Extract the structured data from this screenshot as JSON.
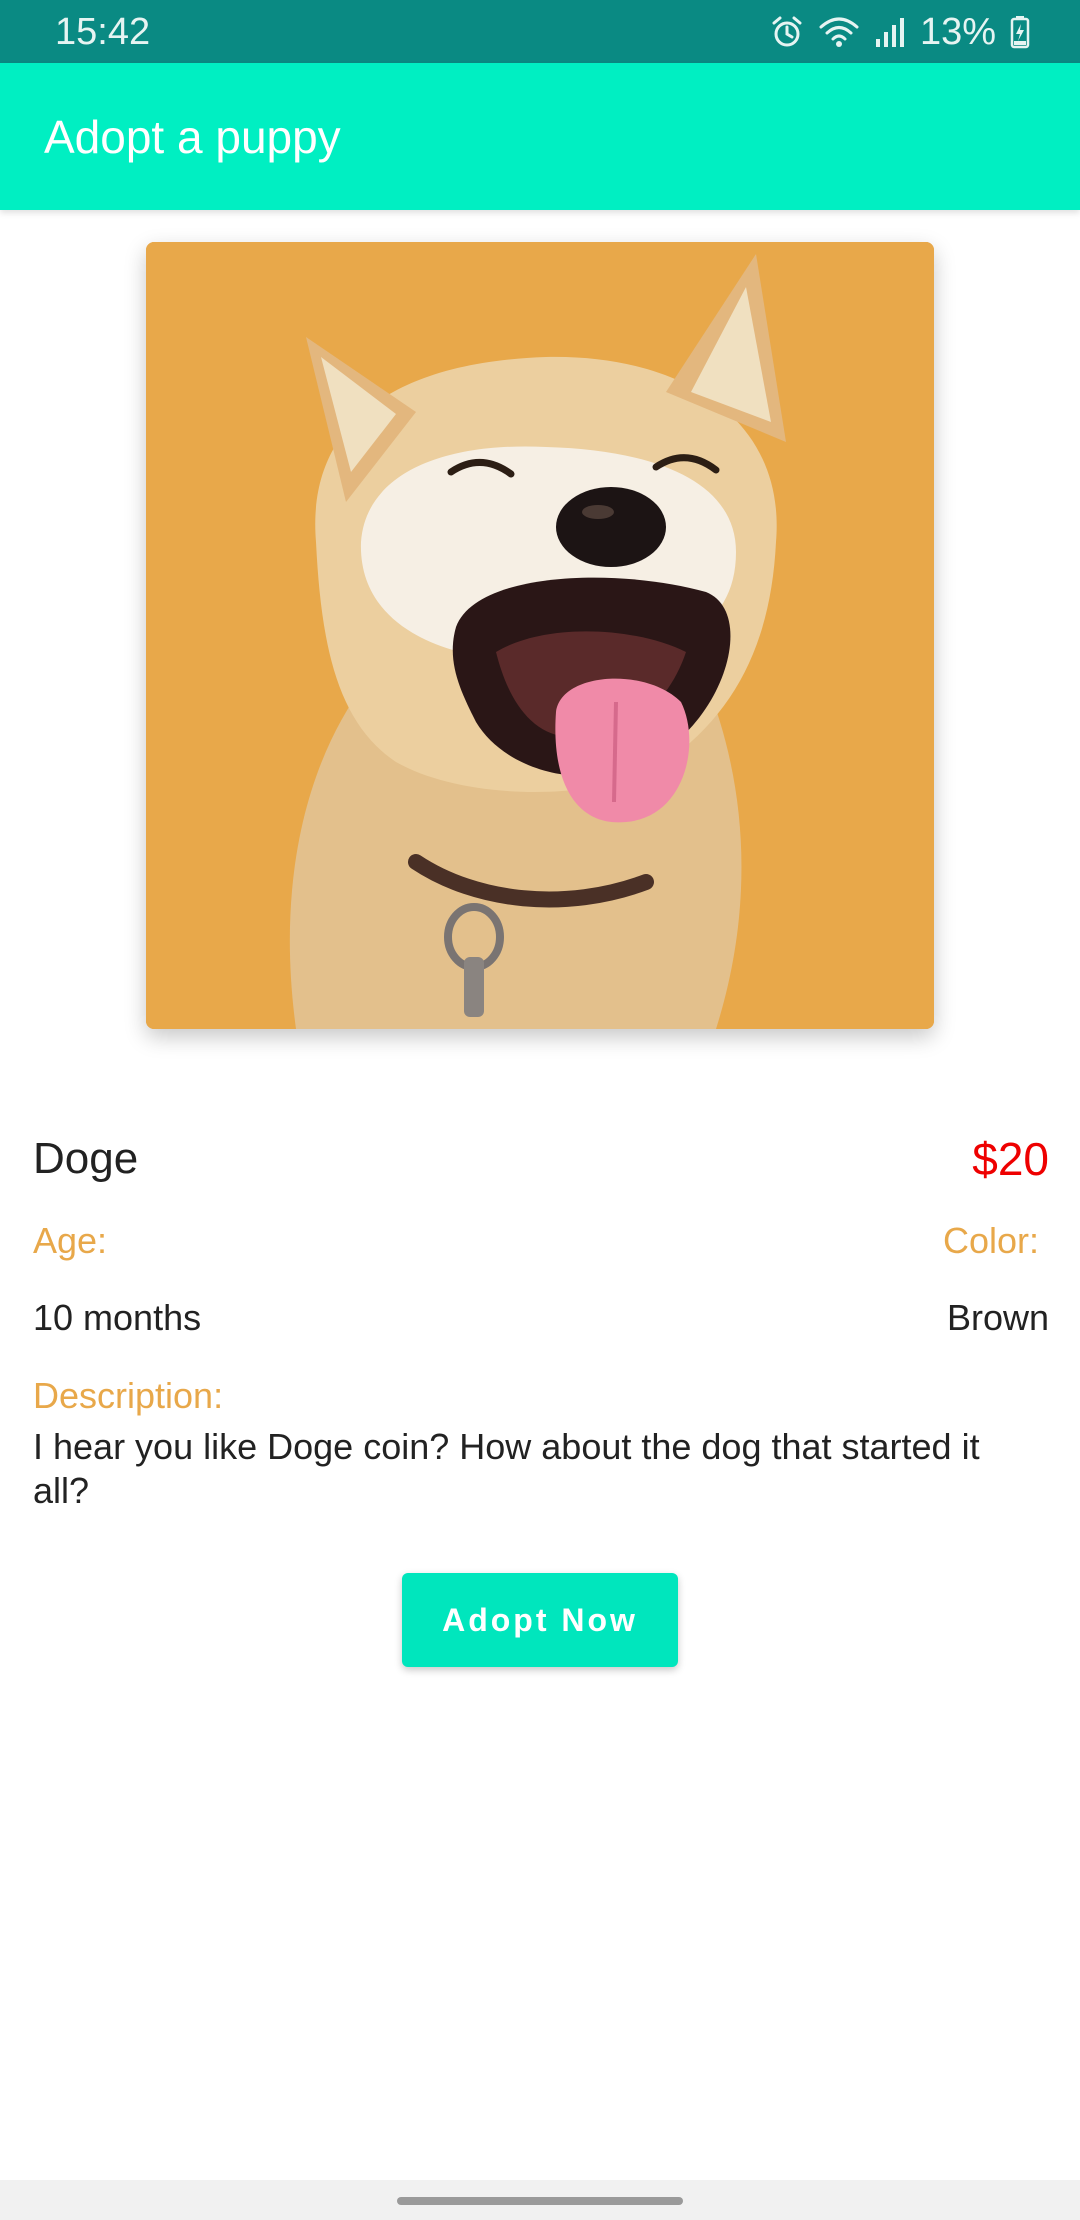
{
  "status_bar": {
    "time": "15:42",
    "battery_text": "13%",
    "icons": [
      "alarm-icon",
      "wifi-icon",
      "signal-icon",
      "battery-icon"
    ]
  },
  "app_bar": {
    "title": "Adopt a puppy"
  },
  "pet": {
    "photo_icon": "dog-photo",
    "name": "Doge",
    "price": "$20",
    "age_label": "Age:",
    "age_value": "10 months",
    "color_label": "Color:",
    "color_value": "Brown",
    "description_label": "Description:",
    "description": "I hear you like Doge coin? How about the dog that started it all?"
  },
  "actions": {
    "adopt_label": "Adopt Now"
  },
  "colors": {
    "status_bar": "#0a8a83",
    "app_bar": "#00efc2",
    "accent": "#00e6bd",
    "label": "#e8a84a",
    "price": "#ee0000",
    "photo_background": "#e8a84a"
  }
}
